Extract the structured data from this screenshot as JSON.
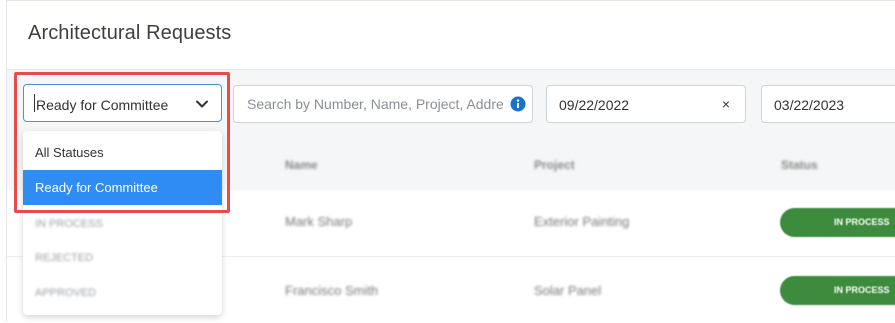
{
  "page": {
    "title": "Architectural Requests"
  },
  "filters": {
    "status_select": {
      "value": "Ready for Committee"
    },
    "search": {
      "placeholder": "Search by Number, Name, Project, Address or"
    },
    "date_from": {
      "value": "09/22/2022",
      "clear_label": "×"
    },
    "date_to": {
      "value": "03/22/2023"
    }
  },
  "status_options": [
    {
      "label": "All Statuses"
    },
    {
      "label": "Ready for Committee",
      "selected": true
    },
    {
      "label": "IN PROCESS"
    },
    {
      "label": "REJECTED"
    },
    {
      "label": "APPROVED"
    }
  ],
  "table": {
    "columns": [
      "Name",
      "Project",
      "Status"
    ],
    "rows": [
      {
        "name": "Mark Sharp",
        "project": "Exterior Painting",
        "status": "IN PROCESS"
      },
      {
        "name": "Francisco Smith",
        "project": "Solar Panel",
        "status": "IN PROCESS"
      }
    ]
  },
  "colors": {
    "accent": "#2f8cf2",
    "highlight": "#e74c4c",
    "status_green": "#3d8b3d"
  }
}
